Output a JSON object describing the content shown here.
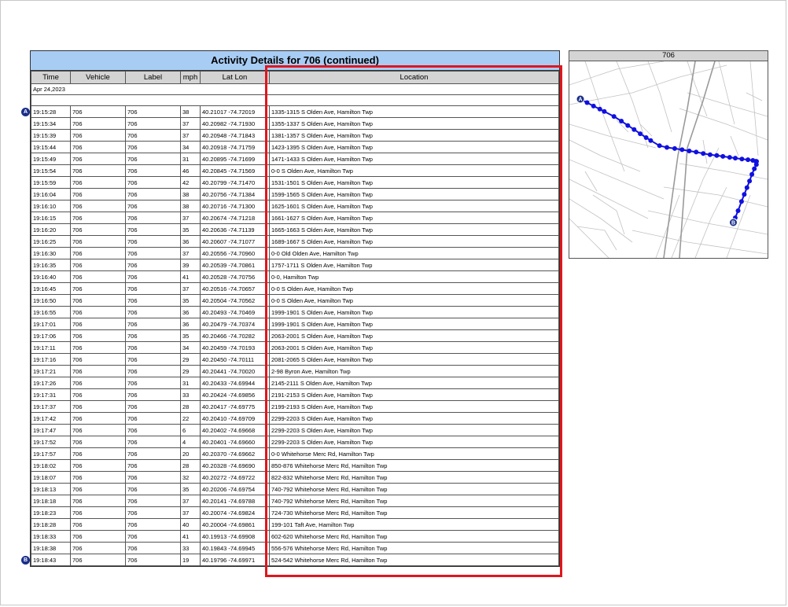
{
  "report": {
    "title": "Activity Details for 706 (continued)",
    "columns": [
      "Time",
      "Vehicle",
      "Label",
      "mph",
      "Lat Lon",
      "Location"
    ],
    "date": "Apr 24,2023",
    "rows": [
      {
        "time": "19:15:28",
        "vehicle": "706",
        "label": "706",
        "mph": "38",
        "latlon": "40.21017 -74.72019",
        "location": "1335-1315 S Olden Ave, Hamilton Twp"
      },
      {
        "time": "19:15:34",
        "vehicle": "706",
        "label": "706",
        "mph": "37",
        "latlon": "40.20982 -74.71930",
        "location": "1355-1337 S Olden Ave, Hamilton Twp"
      },
      {
        "time": "19:15:39",
        "vehicle": "706",
        "label": "706",
        "mph": "37",
        "latlon": "40.20948 -74.71843",
        "location": "1381-1357 S Olden Ave, Hamilton Twp"
      },
      {
        "time": "19:15:44",
        "vehicle": "706",
        "label": "706",
        "mph": "34",
        "latlon": "40.20918 -74.71759",
        "location": "1423-1395 S Olden Ave, Hamilton Twp"
      },
      {
        "time": "19:15:49",
        "vehicle": "706",
        "label": "706",
        "mph": "31",
        "latlon": "40.20895 -74.71699",
        "location": "1471-1433 S Olden Ave, Hamilton Twp"
      },
      {
        "time": "19:15:54",
        "vehicle": "706",
        "label": "706",
        "mph": "46",
        "latlon": "40.20845 -74.71569",
        "location": "0-0 S Olden Ave, Hamilton Twp"
      },
      {
        "time": "19:15:59",
        "vehicle": "706",
        "label": "706",
        "mph": "42",
        "latlon": "40.20799 -74.71470",
        "location": "1531-1501 S Olden Ave, Hamilton Twp"
      },
      {
        "time": "19:16:04",
        "vehicle": "706",
        "label": "706",
        "mph": "38",
        "latlon": "40.20756 -74.71384",
        "location": "1599-1565 S Olden Ave, Hamilton Twp"
      },
      {
        "time": "19:16:10",
        "vehicle": "706",
        "label": "706",
        "mph": "38",
        "latlon": "40.20716 -74.71300",
        "location": "1625-1601 S Olden Ave, Hamilton Twp"
      },
      {
        "time": "19:16:15",
        "vehicle": "706",
        "label": "706",
        "mph": "37",
        "latlon": "40.20674 -74.71218",
        "location": "1661-1627 S Olden Ave, Hamilton Twp"
      },
      {
        "time": "19:16:20",
        "vehicle": "706",
        "label": "706",
        "mph": "35",
        "latlon": "40.20636 -74.71139",
        "location": "1665-1663 S Olden Ave, Hamilton Twp"
      },
      {
        "time": "19:16:25",
        "vehicle": "706",
        "label": "706",
        "mph": "36",
        "latlon": "40.20607 -74.71077",
        "location": "1689-1667 S Olden Ave, Hamilton Twp"
      },
      {
        "time": "19:16:30",
        "vehicle": "706",
        "label": "706",
        "mph": "37",
        "latlon": "40.20556 -74.70960",
        "location": "0-0 Old Olden Ave, Hamilton Twp"
      },
      {
        "time": "19:16:35",
        "vehicle": "706",
        "label": "706",
        "mph": "39",
        "latlon": "40.20539 -74.70861",
        "location": "1757-1711 S Olden Ave, Hamilton Twp"
      },
      {
        "time": "19:16:40",
        "vehicle": "706",
        "label": "706",
        "mph": "41",
        "latlon": "40.20528 -74.70756",
        "location": "0-0, Hamilton Twp"
      },
      {
        "time": "19:16:45",
        "vehicle": "706",
        "label": "706",
        "mph": "37",
        "latlon": "40.20516 -74.70657",
        "location": "0-0 S Olden Ave, Hamilton Twp"
      },
      {
        "time": "19:16:50",
        "vehicle": "706",
        "label": "706",
        "mph": "35",
        "latlon": "40.20504 -74.70562",
        "location": "0-0 S Olden Ave, Hamilton Twp"
      },
      {
        "time": "19:16:55",
        "vehicle": "706",
        "label": "706",
        "mph": "36",
        "latlon": "40.20493 -74.70469",
        "location": "1999-1901 S Olden Ave, Hamilton Twp"
      },
      {
        "time": "19:17:01",
        "vehicle": "706",
        "label": "706",
        "mph": "36",
        "latlon": "40.20479 -74.70374",
        "location": "1999-1901 S Olden Ave, Hamilton Twp"
      },
      {
        "time": "19:17:06",
        "vehicle": "706",
        "label": "706",
        "mph": "35",
        "latlon": "40.20466 -74.70282",
        "location": "2063-2001 S Olden Ave, Hamilton Twp"
      },
      {
        "time": "19:17:11",
        "vehicle": "706",
        "label": "706",
        "mph": "34",
        "latlon": "40.20459 -74.70193",
        "location": "2063-2001 S Olden Ave, Hamilton Twp"
      },
      {
        "time": "19:17:16",
        "vehicle": "706",
        "label": "706",
        "mph": "29",
        "latlon": "40.20450 -74.70111",
        "location": "2081-2065 S Olden Ave, Hamilton Twp"
      },
      {
        "time": "19:17:21",
        "vehicle": "706",
        "label": "706",
        "mph": "29",
        "latlon": "40.20441 -74.70020",
        "location": "2-98 Byron Ave, Hamilton Twp"
      },
      {
        "time": "19:17:26",
        "vehicle": "706",
        "label": "706",
        "mph": "31",
        "latlon": "40.20433 -74.69944",
        "location": "2145-2111 S Olden Ave, Hamilton Twp"
      },
      {
        "time": "19:17:31",
        "vehicle": "706",
        "label": "706",
        "mph": "33",
        "latlon": "40.20424 -74.69856",
        "location": "2191-2153 S Olden Ave, Hamilton Twp"
      },
      {
        "time": "19:17:37",
        "vehicle": "706",
        "label": "706",
        "mph": "28",
        "latlon": "40.20417 -74.69775",
        "location": "2199-2193 S Olden Ave, Hamilton Twp"
      },
      {
        "time": "19:17:42",
        "vehicle": "706",
        "label": "706",
        "mph": "22",
        "latlon": "40.20410 -74.69709",
        "location": "2299-2203 S Olden Ave, Hamilton Twp"
      },
      {
        "time": "19:17:47",
        "vehicle": "706",
        "label": "706",
        "mph": "6",
        "latlon": "40.20402 -74.69668",
        "location": "2299-2203 S Olden Ave, Hamilton Twp"
      },
      {
        "time": "19:17:52",
        "vehicle": "706",
        "label": "706",
        "mph": "4",
        "latlon": "40.20401 -74.69660",
        "location": "2299-2203 S Olden Ave, Hamilton Twp"
      },
      {
        "time": "19:17:57",
        "vehicle": "706",
        "label": "706",
        "mph": "20",
        "latlon": "40.20370 -74.69662",
        "location": "0-0 Whitehorse Merc Rd, Hamilton Twp"
      },
      {
        "time": "19:18:02",
        "vehicle": "706",
        "label": "706",
        "mph": "28",
        "latlon": "40.20328 -74.69690",
        "location": "850-876 Whitehorse Merc Rd, Hamilton Twp"
      },
      {
        "time": "19:18:07",
        "vehicle": "706",
        "label": "706",
        "mph": "32",
        "latlon": "40.20272 -74.69722",
        "location": "822-832 Whitehorse Merc Rd, Hamilton Twp"
      },
      {
        "time": "19:18:13",
        "vehicle": "706",
        "label": "706",
        "mph": "35",
        "latlon": "40.20206 -74.69754",
        "location": "740-792 Whitehorse Merc Rd, Hamilton Twp"
      },
      {
        "time": "19:18:18",
        "vehicle": "706",
        "label": "706",
        "mph": "37",
        "latlon": "40.20141 -74.69788",
        "location": "740-792 Whitehorse Merc Rd, Hamilton Twp"
      },
      {
        "time": "19:18:23",
        "vehicle": "706",
        "label": "706",
        "mph": "37",
        "latlon": "40.20074 -74.69824",
        "location": "724-730 Whitehorse Merc Rd, Hamilton Twp"
      },
      {
        "time": "19:18:28",
        "vehicle": "706",
        "label": "706",
        "mph": "40",
        "latlon": "40.20004 -74.69861",
        "location": "199-101 Taft Ave, Hamilton Twp"
      },
      {
        "time": "19:18:33",
        "vehicle": "706",
        "label": "706",
        "mph": "41",
        "latlon": "40.19913 -74.69908",
        "location": "602-620 Whitehorse Merc Rd, Hamilton Twp"
      },
      {
        "time": "19:18:38",
        "vehicle": "706",
        "label": "706",
        "mph": "33",
        "latlon": "40.19843 -74.69945",
        "location": "556-576 Whitehorse Merc Rd, Hamilton Twp"
      },
      {
        "time": "19:18:43",
        "vehicle": "706",
        "label": "706",
        "mph": "19",
        "latlon": "40.19796 -74.69971",
        "location": "524-542 Whitehorse Merc Rd, Hamilton Twp"
      }
    ]
  },
  "markers": {
    "start": "A",
    "end": "B"
  },
  "map": {
    "title": "706",
    "route_color": "#1010e0",
    "marker_color": "#1a2f8a",
    "highlight_color": "#e0161c"
  }
}
